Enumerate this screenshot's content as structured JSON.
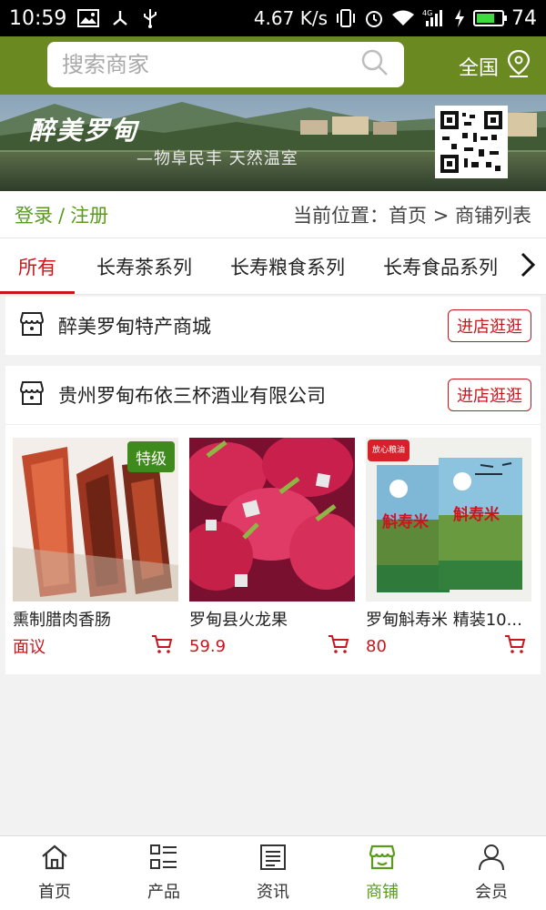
{
  "status_bar": {
    "time": "10:59",
    "speed": "4.67 K/s",
    "network": "4G",
    "battery": "74",
    "battery_level": 0.74
  },
  "header": {
    "search_placeholder": "搜索商家",
    "region": "全国"
  },
  "banner": {
    "title": "醉美罗甸",
    "subtitle": "物阜民丰 天然温室"
  },
  "crumbbar": {
    "login": "登录",
    "separator": "/",
    "register": "注册",
    "location": "当前位置：首页 > 商铺列表"
  },
  "tabs": [
    {
      "label": "所有",
      "active": true
    },
    {
      "label": "长寿茶系列",
      "active": false
    },
    {
      "label": "长寿粮食系列",
      "active": false
    },
    {
      "label": "长寿食品系列",
      "active": false
    }
  ],
  "stores": [
    {
      "name": "醉美罗甸特产商城",
      "visit_label": "进店逛逛"
    },
    {
      "name": "贵州罗甸布依三杯酒业有限公司",
      "visit_label": "进店逛逛",
      "products": [
        {
          "name": "熏制腊肉香肠",
          "price": "面议",
          "badge": "特级"
        },
        {
          "name": "罗甸县火龙果",
          "price": "59.9"
        },
        {
          "name": "罗甸斛寿米 精装10...",
          "price": "80",
          "badge": "放心粮油",
          "package_text": "斛寿米"
        }
      ]
    }
  ],
  "bottom_nav": [
    {
      "label": "首页",
      "icon": "home-icon"
    },
    {
      "label": "产品",
      "icon": "grid-list-icon"
    },
    {
      "label": "资讯",
      "icon": "news-icon"
    },
    {
      "label": "商铺",
      "icon": "shop-icon",
      "active": true
    },
    {
      "label": "会员",
      "icon": "user-icon"
    }
  ],
  "colors": {
    "header_green": "#6a8a21",
    "accent_red": "#c8161d",
    "link_green": "#5b9b1c"
  }
}
